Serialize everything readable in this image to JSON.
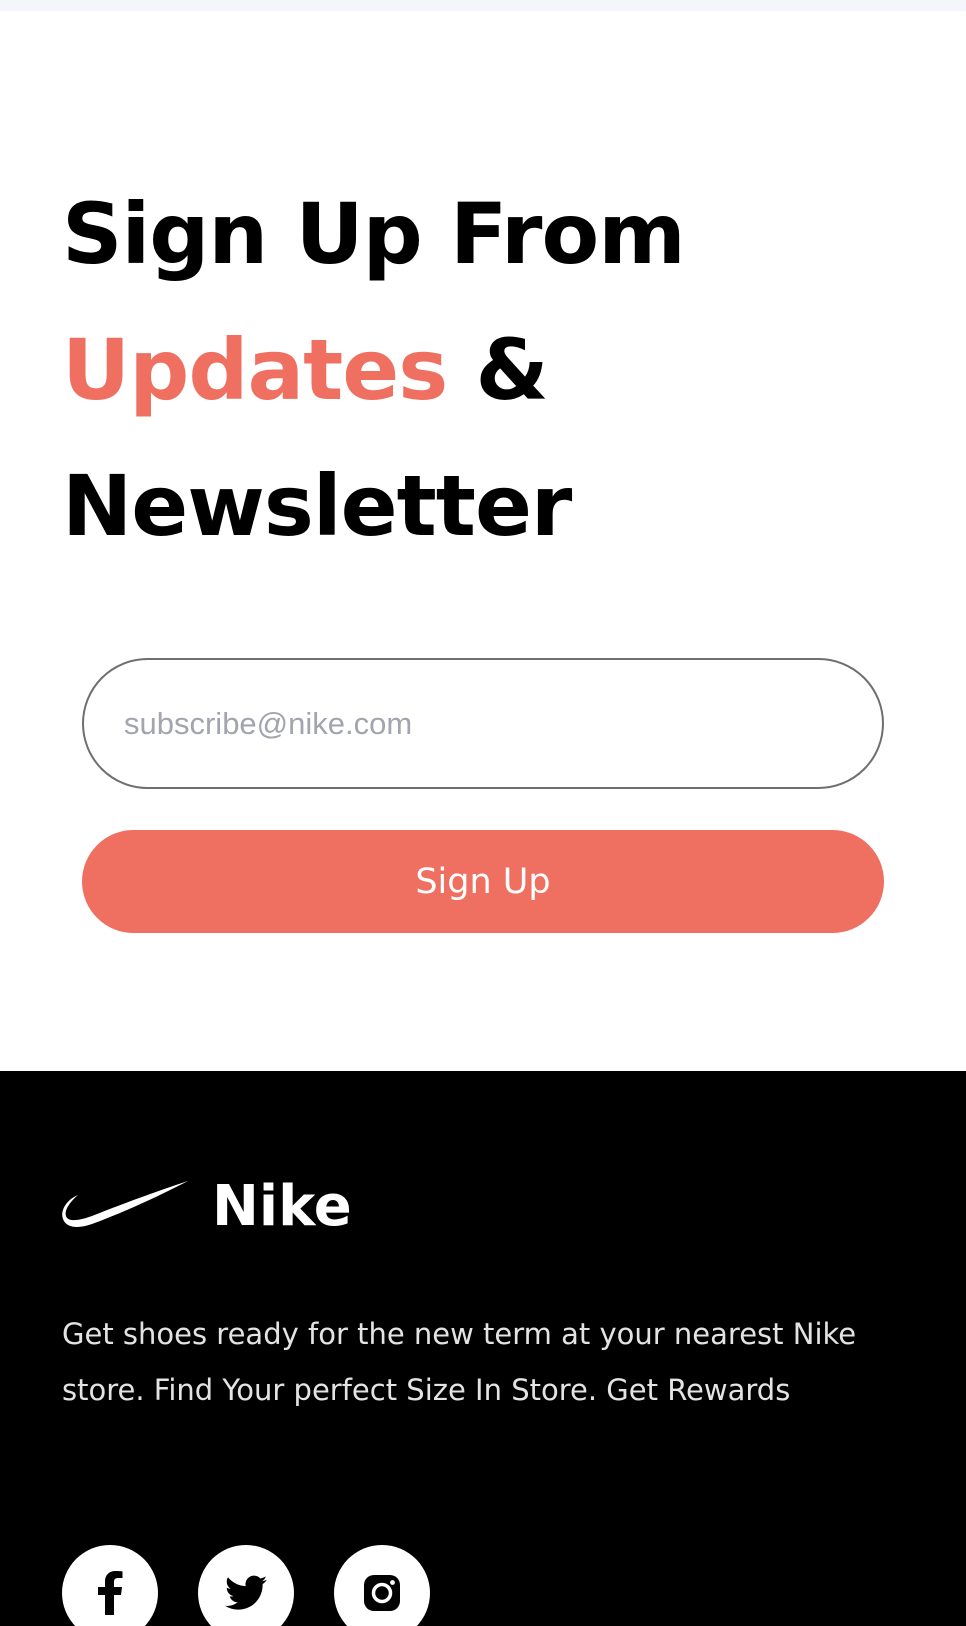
{
  "newsletter": {
    "headline_line1": "Sign Up From",
    "headline_accent": "Updates",
    "headline_amp": "&",
    "headline_line3": "Newsletter",
    "email_placeholder": "subscribe@nike.com",
    "email_value": "",
    "signup_label": "Sign Up"
  },
  "footer": {
    "brand_name": "Nike",
    "logo_icon": "nike-swoosh-icon",
    "description": "Get shoes ready for the new term at your nearest Nike store. Find Your perfect Size In Store. Get Rewards",
    "social": [
      {
        "icon": "facebook-icon"
      },
      {
        "icon": "twitter-icon"
      },
      {
        "icon": "instagram-icon"
      }
    ]
  },
  "colors": {
    "accent": "#ef7060",
    "footer_background": "#000000",
    "page_background": "#ffffff"
  }
}
